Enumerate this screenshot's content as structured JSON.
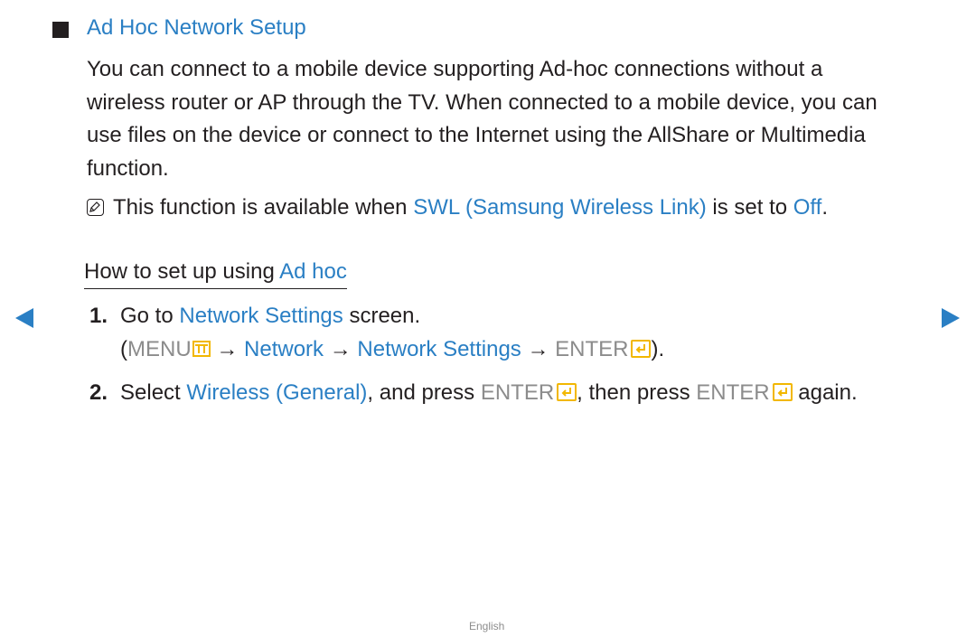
{
  "section": {
    "title": "Ad Hoc Network Setup",
    "paragraph_lines": [
      "You can connect to a mobile device supporting Ad-hoc connections without a",
      "wireless router or AP through the TV. When connected to a mobile device, you can",
      "use files on the device or connect to the Internet using the AllShare or Multimedia",
      "function."
    ],
    "note": {
      "icon": "note-icon",
      "prefix": "This function is available when ",
      "swl": "SWL (Samsung Wireless Link)",
      "mid": " is set to ",
      "off": "Off",
      "end": "."
    }
  },
  "howto": {
    "prefix": "How to set up using ",
    "highlight": "Ad hoc"
  },
  "steps": [
    {
      "number": "1.",
      "text_go": "Go to ",
      "network_settings": "Network Settings",
      "text_screen": " screen.",
      "path_open": "(",
      "menu": "MENU",
      "arrow1": " → ",
      "network": "Network",
      "arrow2": " → ",
      "network_settings2": "Network Settings",
      "arrow3": " → ",
      "enter": "ENTER",
      "path_close": ")."
    },
    {
      "number": "2.",
      "text_select": "Select ",
      "wireless": "Wireless (General)",
      "text_press": ", and press ",
      "enter1": "ENTER",
      "text_then": ", then press ",
      "enter2": "ENTER",
      "text_again": " again."
    }
  ],
  "navigation": {
    "prev": "previous-page",
    "next": "next-page"
  },
  "footer": {
    "language": "English"
  },
  "colors": {
    "accent_blue": "#2a7fc4",
    "key_gray": "#8c8c8c",
    "icon_yellow": "#f2b700",
    "text": "#231f20"
  }
}
